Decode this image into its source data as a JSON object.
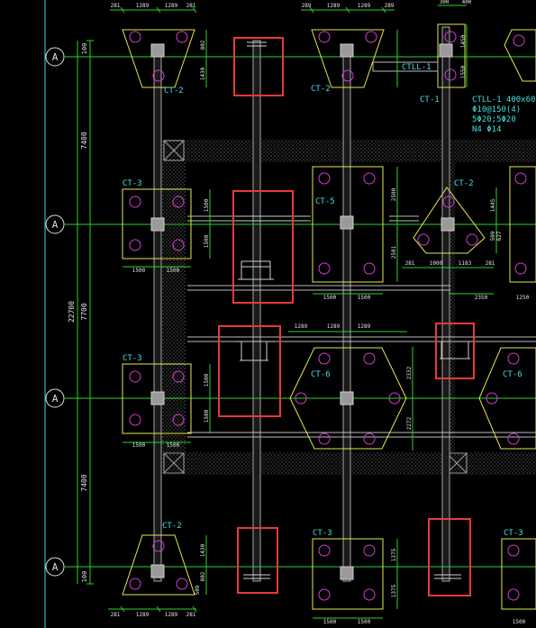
{
  "colors": {
    "background": "#000000",
    "pile_cap": "#e6e64a",
    "pile": "#d43cd4",
    "dimension": "#2fd12f",
    "column": "#a8a8a8",
    "grid_axis": "#40e0e0",
    "beam": "#bdbdbd",
    "callout": "#e8393b",
    "label": "#40e0e0"
  },
  "axes": [
    {
      "label": "A"
    },
    {
      "label": "A"
    },
    {
      "label": "A"
    },
    {
      "label": "A"
    }
  ],
  "vertical_dims": [
    "100",
    "7400",
    "22700",
    "7700",
    "7400",
    "100"
  ],
  "cap_labels": {
    "ct2_tl": "CT-2",
    "ct2_t2": "CT-2",
    "ct1": "CT-1",
    "ctll": "CTLL-1",
    "ct3_l": "CT-3",
    "ct5": "CT-5",
    "ct2_r": "CT-2",
    "ct3_m": "CT-3",
    "ct6_m": "CT-6",
    "ct6_r": "CT-6",
    "ct2_bl": "CT-2",
    "ct3_b": "CT-3",
    "ct3_br": "CT-3"
  },
  "beam_note": [
    "CTLL-1 400x600",
    "Φ10@150(4)",
    "5Φ20;5Φ20",
    "N4 Φ14"
  ],
  "dims": {
    "t1": "281",
    "t2": "1289",
    "t3": "1289",
    "t4": "281",
    "t5": "289",
    "t6": "1289",
    "t7": "1289",
    "t8": "289",
    "t9": "300",
    "t10": "400",
    "d_802": "802",
    "d_1430": "1430",
    "d_1450": "1450",
    "d_1550": "1550",
    "d_7400": "7400",
    "d_1500a": "1500",
    "d_1500b": "1500",
    "d_ct3w": "1500",
    "d_ct3w2": "1500",
    "d_2500": "2500",
    "d_2501": "2501",
    "d_ct5a": "1500",
    "d_ct5b": "1500",
    "d_1445": "1445",
    "d_509": "509",
    "d_627": "627",
    "d_281": "281",
    "d_1000": "1000",
    "d_1183": "1183",
    "d_281b": "281",
    "d_2350": "2350",
    "d_1250": "1250",
    "d_m1289a": "1289",
    "d_m1289b": "1289",
    "d_m1289c": "1289",
    "d_m1500a": "1500",
    "d_m1500b": "1500",
    "d_m1500c": "1500",
    "d_m1500d": "1500",
    "d_2332": "2332",
    "d_2272": "2272",
    "d_b1430": "1430",
    "d_b802": "802",
    "d_b509": "509",
    "d_b281a": "281",
    "d_b1289a": "1289",
    "d_b1289b": "1289",
    "d_b281b": "281",
    "d_b1375a": "1375",
    "d_b1375b": "1375",
    "d_b1500a": "1500",
    "d_b1500b": "1500",
    "d_b1500c": "1500"
  }
}
